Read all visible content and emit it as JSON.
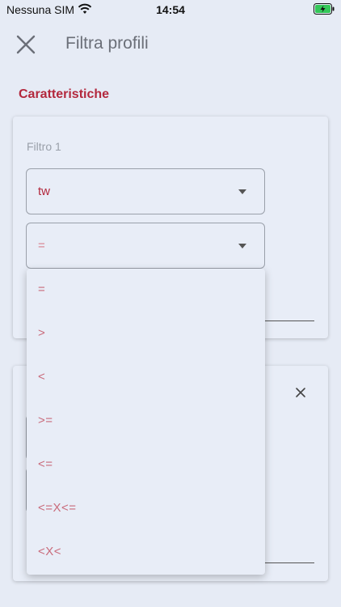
{
  "status_bar": {
    "carrier": "Nessuna SIM",
    "time": "14:54"
  },
  "header": {
    "title": "Filtra profili"
  },
  "section": {
    "title": "Caratteristiche"
  },
  "filter1": {
    "label": "Filtro 1",
    "field_value": "tw",
    "operator_value": "="
  },
  "dropdown": {
    "options": [
      "=",
      ">",
      "<",
      ">=",
      "<=",
      "<=X<=",
      "<X<"
    ]
  },
  "colors": {
    "accent": "#b3283d",
    "background": "#e6ebf5",
    "option_text": "#c96b7b"
  }
}
